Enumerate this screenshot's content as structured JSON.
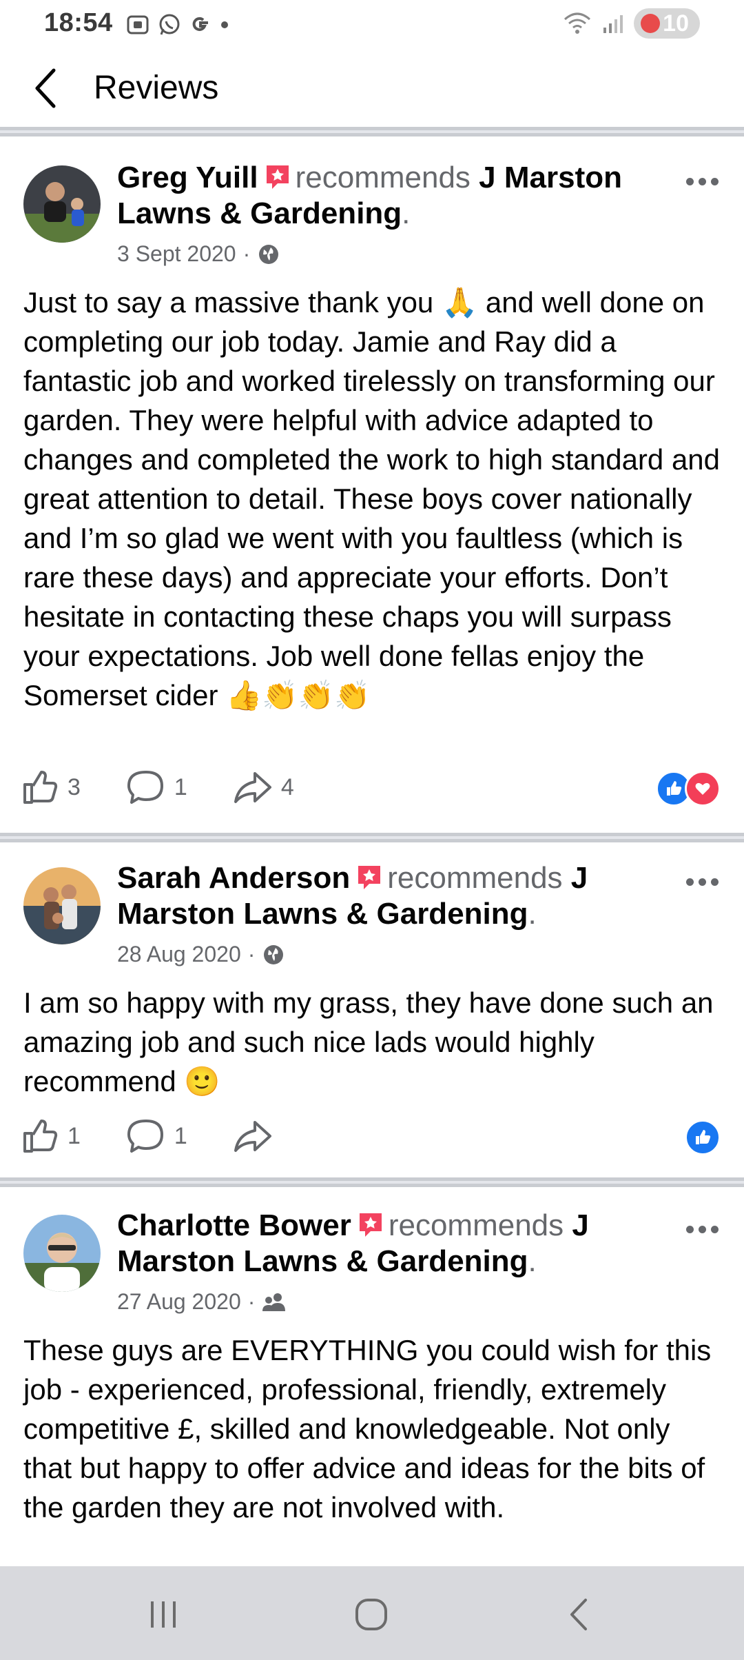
{
  "status_bar": {
    "time": "18:54",
    "battery": "10"
  },
  "header": {
    "title": "Reviews"
  },
  "reviews": [
    {
      "author": "Greg Yuill",
      "verb": "recommends",
      "page": "J Marston Lawns & Gardening",
      "date": "3 Sept 2020",
      "audience_icon": "globe-icon",
      "text": "Just to say a massive thank you 🙏 and well done on completing our job today. Jamie and Ray did a fantastic job and worked tirelessly on transforming our garden. They were helpful with advice adapted to changes and completed the work to high standard and great attention to detail. These boys cover nationally and I’m so glad we went with you faultless (which is rare these days) and appreciate your efforts. Don’t hesitate in contacting these chaps you will surpass your expectations. Job well done fellas enjoy the Somerset cider 👍👏👏👏",
      "likes": "3",
      "comments": "1",
      "shares": "4",
      "reactions": [
        "like",
        "love"
      ]
    },
    {
      "author": "Sarah Anderson",
      "verb": "recommends",
      "page": "J Marston Lawns & Gardening",
      "date": "28 Aug 2020",
      "audience_icon": "globe-icon",
      "text": "I am so happy with my grass, they have done such an amazing job and such nice lads would highly recommend 🙂",
      "likes": "1",
      "comments": "1",
      "shares": "",
      "reactions": [
        "like"
      ]
    },
    {
      "author": "Charlotte Bower",
      "verb": "recommends",
      "page": "J Marston Lawns & Gardening",
      "date": "27 Aug 2020",
      "audience_icon": "friends-icon",
      "text": "These guys are EVERYTHING you could wish for this job - experienced, professional, friendly, extremely competitive £, skilled and knowledgeable. Not only that but happy to offer advice and ideas for the bits of the garden they are not involved with."
    }
  ],
  "colors": {
    "accent_blue": "#1877f2",
    "love_red": "#f33e58",
    "secondary_text": "#65676b",
    "divider": "#c9ccd1"
  }
}
